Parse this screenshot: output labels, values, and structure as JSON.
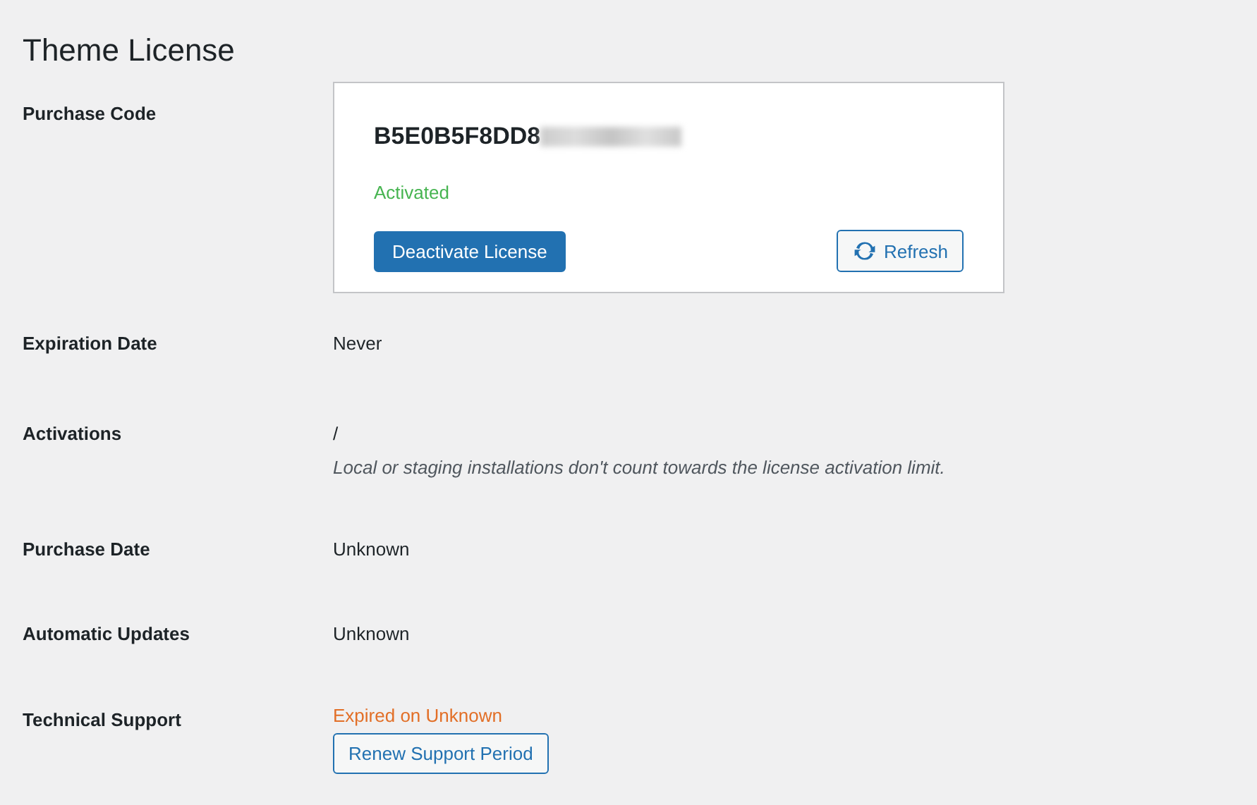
{
  "title": "Theme License",
  "rows": [
    {
      "kind": "code",
      "label": "Purchase Code",
      "code": "B5E0B5F8DD8",
      "status": "Activated",
      "primary_button": "Deactivate License",
      "refresh_button": "Refresh"
    },
    {
      "kind": "text",
      "label": "Expiration Date",
      "value": "Never"
    },
    {
      "kind": "note",
      "label": "Activations",
      "value": "/",
      "note": "Local or staging installations don't count towards the license activation limit."
    },
    {
      "kind": "text",
      "label": "Purchase Date",
      "value": "Unknown"
    },
    {
      "kind": "text",
      "label": "Automatic Updates",
      "value": "Unknown"
    },
    {
      "kind": "support",
      "label": "Technical Support",
      "value": "Expired on Unknown",
      "button": "Renew Support Period"
    }
  ]
}
